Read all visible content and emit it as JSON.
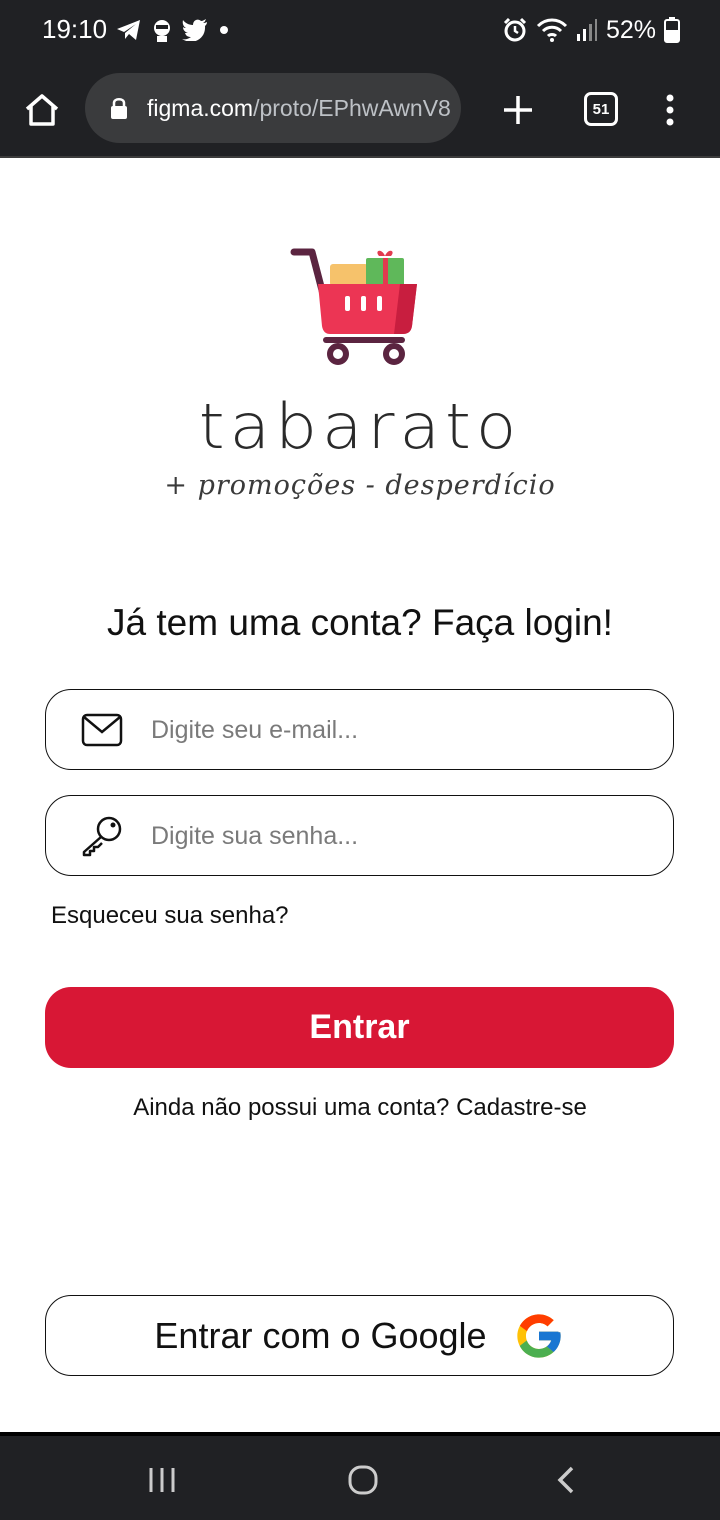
{
  "status_bar": {
    "time": "19:10",
    "battery": "52%",
    "left_icons": [
      "telegram-icon",
      "agent-icon",
      "twitter-icon",
      "dot-icon"
    ],
    "right_icons": [
      "alarm-icon",
      "wifi-icon",
      "signal-icon",
      "battery-icon"
    ]
  },
  "browser": {
    "url_domain": "figma.com",
    "url_path": "/proto/EPhwAwnV8",
    "tab_count": "51"
  },
  "logo": {
    "wordmark": "tabarato",
    "tagline": "+ promoções - desperdício"
  },
  "login": {
    "title": "Já tem uma conta? Faça login!",
    "email_placeholder": "Digite seu e-mail...",
    "password_placeholder": "Digite sua senha...",
    "forgot_password": "Esqueceu sua senha?",
    "submit_label": "Entrar",
    "no_account_text": "Ainda não possui uma conta?",
    "signup_label": "Cadastre-se",
    "google_label": "Entrar com o Google"
  },
  "colors": {
    "brand_red": "#d81735",
    "dark_bar": "#202124"
  }
}
